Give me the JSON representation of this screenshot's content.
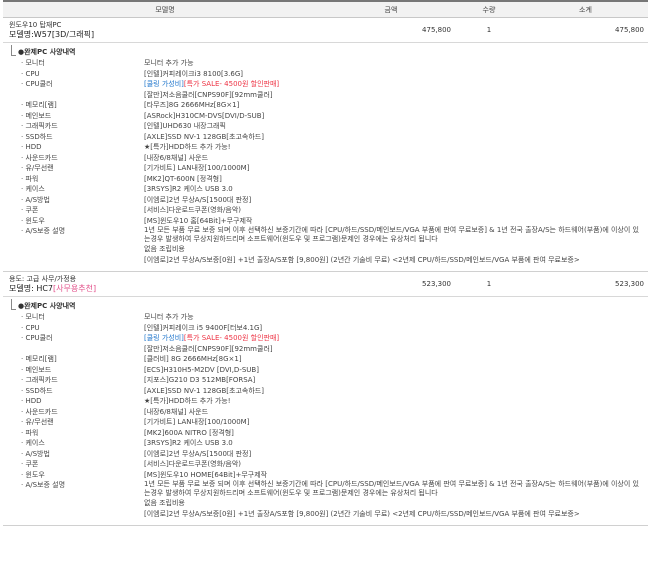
{
  "header": {
    "model": "모델명",
    "price": "금액",
    "qty": "수량",
    "total": "소계"
  },
  "products": [
    {
      "title": "윈도우10 탑재PC",
      "subtitle_prefix": "모델명:",
      "subtitle_value": "W57[3D/그래픽]",
      "subtitle_tag": "",
      "price": "475,800",
      "qty": "1",
      "total": "475,800",
      "spec_title": "●완제PC 사양내역",
      "specs": [
        {
          "label": "· 모니터",
          "value": "모니터 추가 가능"
        },
        {
          "label": "· CPU",
          "value": "[인텔]커피레이크i3 8100[3.6G]"
        },
        {
          "label": "· CPU쿨러",
          "value": "[쿨링 가성비][특가 SALE- 4500원 할인판매]",
          "value2": "[잘만]저소음쿨러[CNPS90F][92mm쿨러]"
        },
        {
          "label": "· 메모리[램]",
          "value": "[타무즈]8G 2666MHz[8G×1]"
        },
        {
          "label": "· 메인보드",
          "value": "[ASRock]H310CM-DVS[DVI/D-SUB]"
        },
        {
          "label": "· 그래픽카드",
          "value": "[인텔]UHD630 내장그래픽"
        },
        {
          "label": "· SSD하드",
          "value": "[AXLE]SSD NV-1 128GB[초고속하드]"
        },
        {
          "label": "· HDD",
          "value": "★[특가]HDD하드 추가 가능!"
        },
        {
          "label": "· 사운드카드",
          "value": "[내장6/8채널] 사운드"
        },
        {
          "label": "· 유/무선랜",
          "value": "[기가비트] LAN내장[100/1000M]"
        },
        {
          "label": "· 파워",
          "value": "[MK2]QT-600N [정격형]"
        },
        {
          "label": "· 케이스",
          "value": "[3RSYS]R2 케이스 USB 3.0"
        },
        {
          "label": "· A/S방법",
          "value": "[이엠로]2년 무상A/S[1500대 판정]"
        },
        {
          "label": "· 쿠폰",
          "value": "[서비스]다운로드쿠폰(영화/음악)"
        },
        {
          "label": "· 윈도우",
          "value": "[MS]윈도우10 홈[64Bit]+무구제작"
        },
        {
          "label": "· A/S보증 설명",
          "value": "1년 모든 부품 무료 보증 되며 이후 선택하신 보증기간에 따라 [CPU/하드/SSD/메인보드/VGA 부품에 판여 무료보증] & 1년 전국 출장A/S는 하드웨어(부품)에 이상이 있는경우 발생하여 무상지원하드리며 소프트웨어(윈도우 및 프로그램)문제인 경우에는 유상처리 됩니다",
          "multi": true
        },
        {
          "label": "",
          "value": "없음 조립비용"
        },
        {
          "label": "",
          "value": "[이엠로]2년 무상A/S보증[0원] +1년 출장A/S포함 [9,800원] (2년간 기술비 무료) <2년제 CPU/하드/SSD/메인보드/VGA 부품에 판여 무료보증>"
        }
      ]
    },
    {
      "title": "용도: 고급 사무/가정용",
      "subtitle_prefix": "모델명: ",
      "subtitle_value": "HC7",
      "subtitle_tag": "[사무용추천]",
      "price": "523,300",
      "qty": "1",
      "total": "523,300",
      "spec_title": "●완제PC 사양내역",
      "specs": [
        {
          "label": "· 모니터",
          "value": "모니터 추가 가능"
        },
        {
          "label": "· CPU",
          "value": "[인텔]커피레이크 i5 9400F[터보4.1G]"
        },
        {
          "label": "· CPU쿨러",
          "value": "[쿨링 가성비][특가 SALE- 4500원 할인판매]",
          "value2": "[잘만]저소음쿨러[CNPS90F][92mm쿨러]"
        },
        {
          "label": "· 메모리[램]",
          "value": "[클러비] 8G 2666MHz[8G×1]"
        },
        {
          "label": "· 메인보드",
          "value": "[ECS]H310H5-M2DV [DVI,D-SUB]"
        },
        {
          "label": "· 그래픽카드",
          "value": "[지포스]G210 D3 512MB[FORSA]"
        },
        {
          "label": "· SSD하드",
          "value": "[AXLE]SSD NV-1 128GB[초고속하드]"
        },
        {
          "label": "· HDD",
          "value": "★[특가]HDD하드 추가 가능!"
        },
        {
          "label": "· 사운드카드",
          "value": "[내장6/8채널] 사운드"
        },
        {
          "label": "· 유/무선랜",
          "value": "[기가비트] LAN내장[100/1000M]"
        },
        {
          "label": "· 파워",
          "value": "[MK2]600A NITRO [정격형]"
        },
        {
          "label": "· 케이스",
          "value": "[3RSYS]R2 케이스 USB 3.0"
        },
        {
          "label": "· A/S방법",
          "value": "[이엠로]2년 무상A/S[1500대 판정]"
        },
        {
          "label": "· 쿠폰",
          "value": "[서비스]다운로드쿠폰(영화/음악)"
        },
        {
          "label": "· 윈도우",
          "value": "[MS]윈도우10 HOME[64Bit]+무구제작"
        },
        {
          "label": "· A/S보증 설명",
          "value": "1년 모든 부품 무료 보증 되며 이후 선택하신 보증기간에 따라 [CPU/하드/SSD/메인보드/VGA 부품에 판여 무료보증] & 1년 전국 출장A/S는 하드웨어(부품)에 이상이 있는경우 발생하여 무상지원하드리며 소프트웨어(윈도우 및 프로그램)문제인 경우에는 유상처리 됩니다",
          "multi": true
        },
        {
          "label": "",
          "value": "없음 조립비용"
        },
        {
          "label": "",
          "value": "[이엠로]2년 무상A/S보증[0원] +1년 출장A/S포함 [9,800원] (2년간 기술비 무료) <2년제 CPU/하드/SSD/메인보드/VGA 부품에 판여 무료보증>"
        }
      ]
    }
  ]
}
